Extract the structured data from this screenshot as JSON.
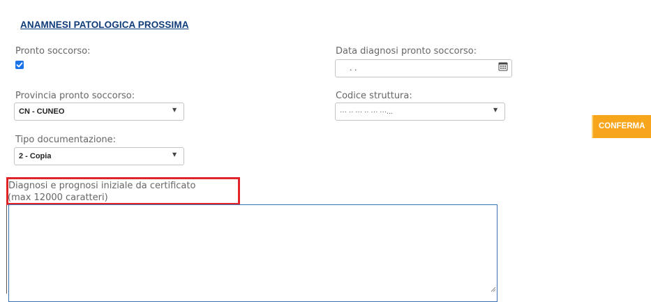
{
  "section": {
    "title": "ANAMNESI PATOLOGICA PROSSIMA"
  },
  "fields": {
    "pronto_soccorso": {
      "label": "Pronto soccorso:",
      "checked": true
    },
    "data_diagnosi": {
      "label": "Data diagnosi pronto soccorso:",
      "value": ".          ."
    },
    "provincia": {
      "label": "Provincia pronto soccorso:",
      "value": "CN - CUNEO"
    },
    "codice_struttura": {
      "label": "Codice struttura:",
      "value": "··· ·· ··· ·· ··· ···..."
    },
    "tipo_documentazione": {
      "label": "Tipo documentazione:",
      "value": "2 - Copia"
    },
    "diagnosi": {
      "label_line1": "Diagnosi e prognosi iniziale da certificato",
      "label_line2": "(max 12000 caratteri)",
      "value": ""
    }
  },
  "actions": {
    "confirm_label": "CONFERMA"
  },
  "icons": {
    "checkbox": "checkmark-icon",
    "calendar": "calendar-icon",
    "dropdown": "dropdown-arrow-icon",
    "resize": "resize-handle-icon"
  },
  "colors": {
    "title": "#0d3b78",
    "checkbox": "#1a73e8",
    "confirm_button": "#f7a51a",
    "highlight_border": "#e0242a",
    "textarea_border": "#3a6fb0"
  }
}
